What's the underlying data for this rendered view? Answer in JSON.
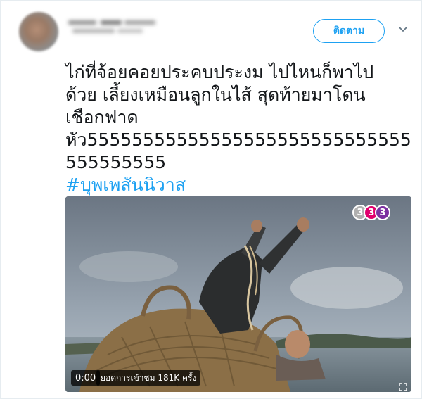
{
  "header": {
    "follow_label": "ติดตาม"
  },
  "tweet": {
    "lines": [
      "ไก่ที่จ้อยคอยประคบประงม ไปไหนก็พาไป",
      "ด้วย เลี้ยงเหมือนลูกในไส้ สุดท้ายมาโดน",
      "เชือกฟาด",
      "หัว55555555555555555555555555555",
      "555555555"
    ],
    "hashtag": "#บุพเพสันนิวาส"
  },
  "media": {
    "time": "0:00",
    "views": "ยอดการเข้าชม 181K ครั้ง",
    "channel_logo": "33 3"
  },
  "colors": {
    "accent": "#1da1f2",
    "text": "#14171a"
  },
  "icons": {
    "caret": "chevron-down-icon",
    "fullscreen": "fullscreen-icon"
  }
}
